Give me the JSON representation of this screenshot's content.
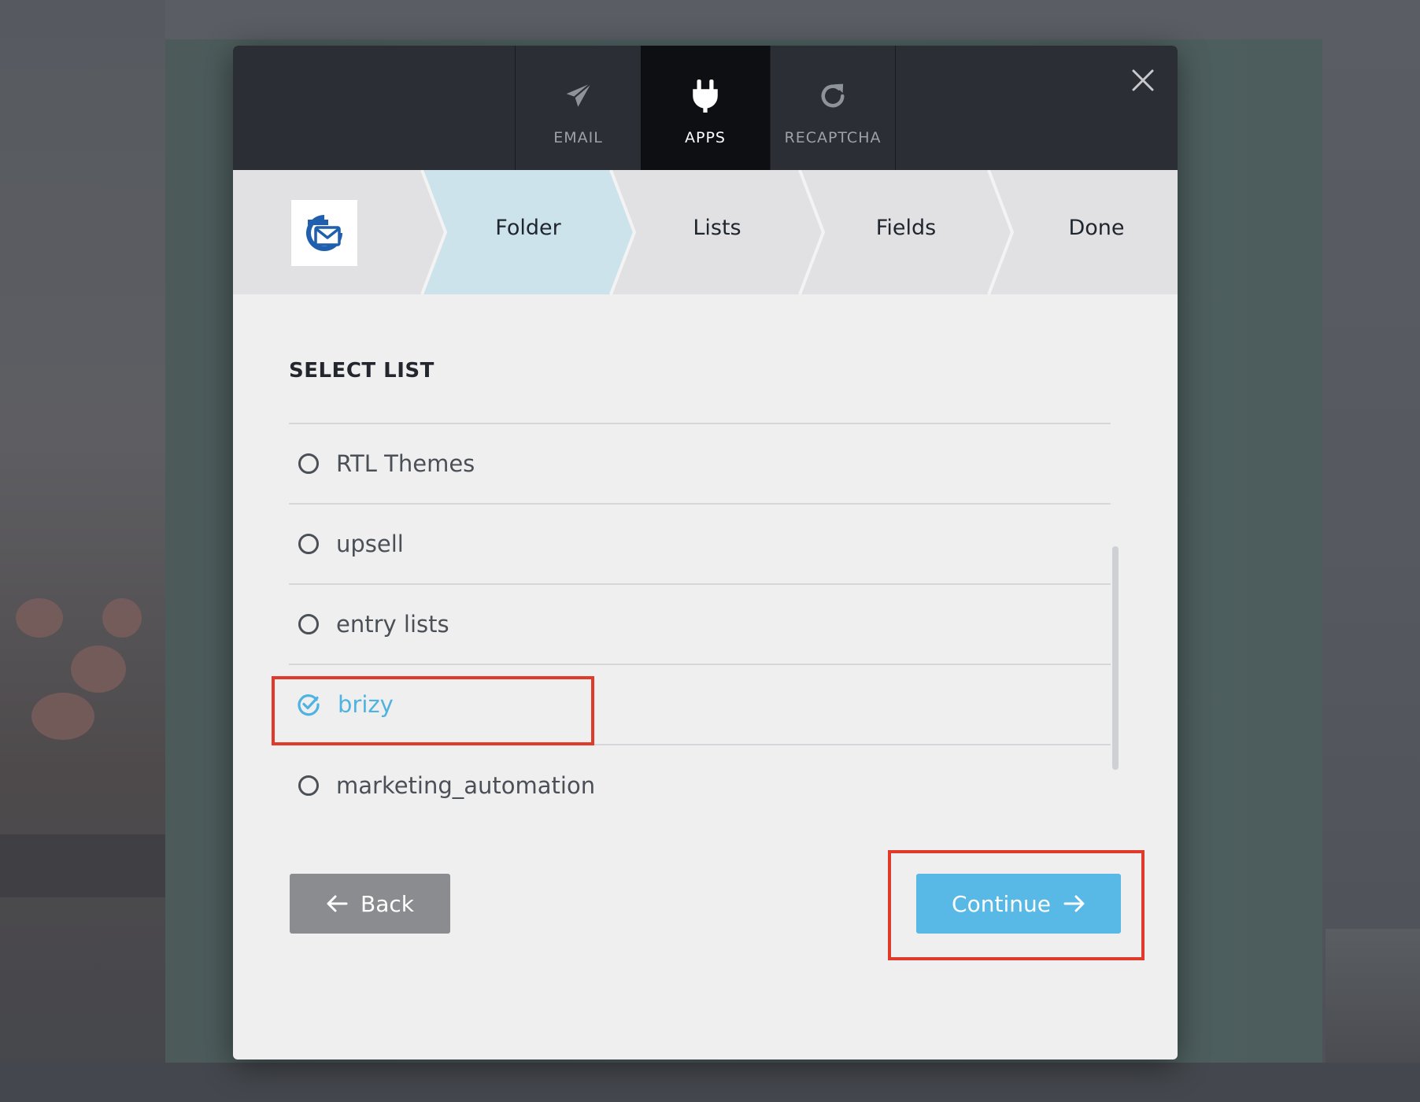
{
  "tabs": [
    {
      "label": "EMAIL",
      "icon": "paper-plane-icon",
      "active": false
    },
    {
      "label": "APPS",
      "icon": "plug-icon",
      "active": true
    },
    {
      "label": "RECAPTCHA",
      "icon": "refresh-icon",
      "active": false
    }
  ],
  "close": {
    "icon": "close-icon"
  },
  "steps": [
    {
      "label": "Folder",
      "active": true
    },
    {
      "label": "Lists",
      "active": false
    },
    {
      "label": "Fields",
      "active": false
    },
    {
      "label": "Done",
      "active": false
    }
  ],
  "integration": {
    "logo_icon": "sendinblue-logo-icon"
  },
  "list": {
    "title": "SELECT LIST",
    "options": [
      {
        "label": "RTL Themes",
        "selected": false
      },
      {
        "label": "upsell",
        "selected": false
      },
      {
        "label": "entry lists",
        "selected": false
      },
      {
        "label": "brizy",
        "selected": true
      },
      {
        "label": "marketing_automation",
        "selected": false
      }
    ]
  },
  "buttons": {
    "back_label": "Back",
    "continue_label": "Continue"
  },
  "colors": {
    "accent": "#58b9e6",
    "active_step": "#cce3ec",
    "topbar": "#2b2e34",
    "highlight": "#e03a2b"
  }
}
